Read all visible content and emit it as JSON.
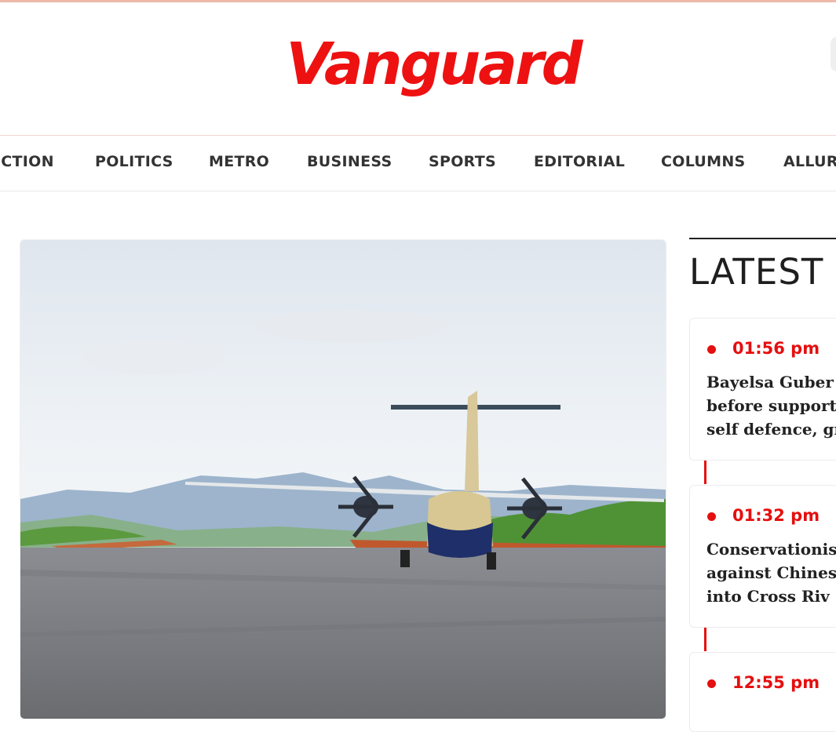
{
  "header": {
    "logo_text": "Vanguard",
    "brand_color": "#ee1111"
  },
  "nav": {
    "items": [
      {
        "label": "ECTION"
      },
      {
        "label": "POLITICS"
      },
      {
        "label": "METRO"
      },
      {
        "label": "BUSINESS"
      },
      {
        "label": "SPORTS"
      },
      {
        "label": "EDITORIAL"
      },
      {
        "label": "COLUMNS"
      },
      {
        "label": "ALLUR"
      }
    ]
  },
  "hero": {
    "image_subject": "aircraft on runway"
  },
  "latest": {
    "title": "LATEST",
    "accent_color": "#e50f0f",
    "items": [
      {
        "time": "01:56 pm",
        "headline_lines": [
          "Bayelsa Guber",
          "before support",
          "self defence, gr"
        ]
      },
      {
        "time": "01:32 pm",
        "headline_lines": [
          "Conservationis",
          "against Chines",
          "into Cross Riv"
        ]
      },
      {
        "time": "12:55 pm",
        "headline_lines": []
      }
    ]
  }
}
